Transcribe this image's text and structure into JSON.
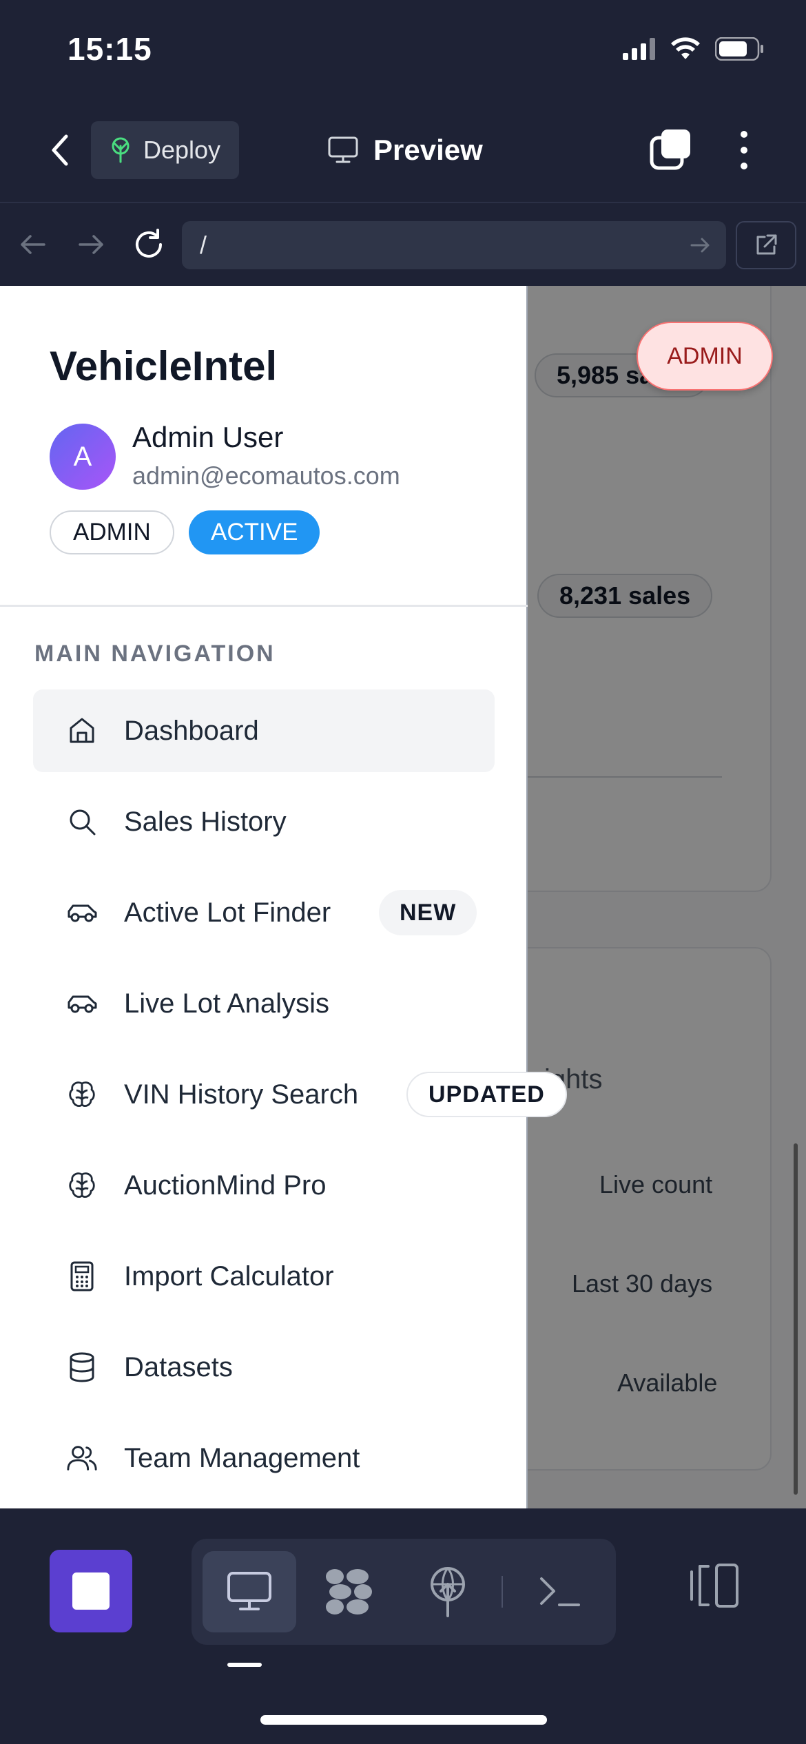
{
  "status_bar": {
    "time": "15:15"
  },
  "header": {
    "deploy_label": "Deploy",
    "preview_label": "Preview"
  },
  "url_bar": {
    "url": "/"
  },
  "background_page": {
    "pill_1": "5,985 sales",
    "pill_2": "8,231 sales",
    "insights_fragment": "ights",
    "row_1": "Live count",
    "row_2": "Last 30 days",
    "row_3": "Available"
  },
  "admin_badge": "ADMIN",
  "drawer": {
    "brand": "VehicleIntel",
    "avatar_initial": "A",
    "user_name": "Admin User",
    "user_email": "admin@ecomautos.com",
    "role_pill": "ADMIN",
    "status_pill": "ACTIVE",
    "section_label": "MAIN NAVIGATION",
    "nav": [
      {
        "label": "Dashboard",
        "icon": "home-icon"
      },
      {
        "label": "Sales History",
        "icon": "search-icon"
      },
      {
        "label": "Active Lot Finder",
        "icon": "car-icon",
        "badge": "NEW"
      },
      {
        "label": "Live Lot Analysis",
        "icon": "car-icon"
      },
      {
        "label": "VIN History Search",
        "icon": "brain-icon",
        "badge": "UPDATED"
      },
      {
        "label": "AuctionMind Pro",
        "icon": "brain-icon"
      },
      {
        "label": "Import Calculator",
        "icon": "calculator-icon"
      },
      {
        "label": "Datasets",
        "icon": "database-icon"
      },
      {
        "label": "Team Management",
        "icon": "users-icon"
      }
    ]
  },
  "colors": {
    "chrome": "#1e2235",
    "active_pill": "#2196f3",
    "stop_button": "#5b3fd0",
    "admin_badge_bg": "#fee2e2",
    "admin_badge_text": "#991b1b"
  }
}
